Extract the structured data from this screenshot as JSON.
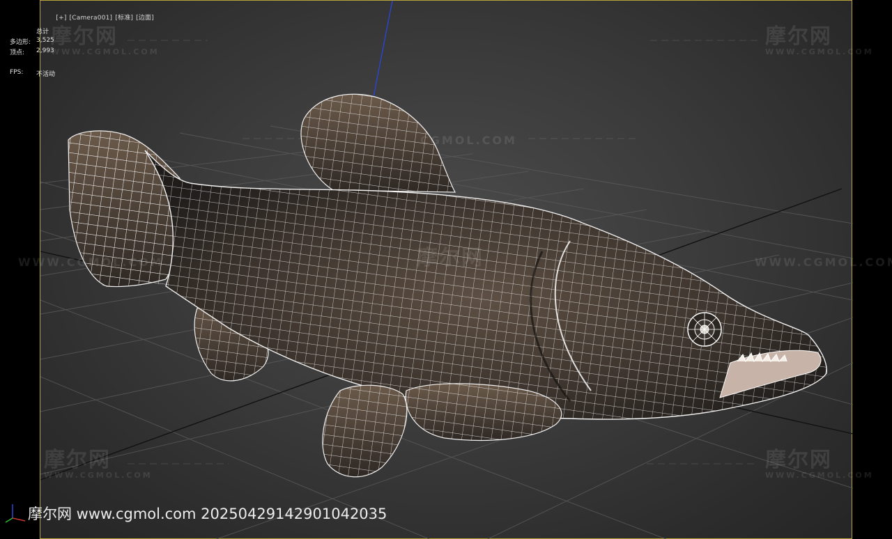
{
  "viewport": {
    "label_plus": "[+]",
    "label_camera": "[Camera001]",
    "label_shading": "[标准]",
    "label_edges": "[边面]"
  },
  "stats": {
    "header": "总计",
    "polygons_label": "多边形:",
    "polygons_value": "3,525",
    "vertices_label": "顶点:",
    "vertices_value": "2,993",
    "fps_label": "FPS:",
    "fps_value": "不活动"
  },
  "watermark": {
    "brand": "摩尔网",
    "domain": "WWW.CGMOL.COM",
    "line_text": "WWW.CGMOL.COM",
    "mid_text": "CGMOL.COM"
  },
  "footer": {
    "text": "摩尔网 www.cgmol.com 20250429142901042035"
  },
  "colors": {
    "viewport_border": "#b9a43a",
    "axis_blue": "#2a46d8",
    "wire": "#ffffff",
    "fish_dark": "#2a2622",
    "fish_mid": "#5a4b3f"
  },
  "icons": [
    "axis-gizmo-icon"
  ]
}
